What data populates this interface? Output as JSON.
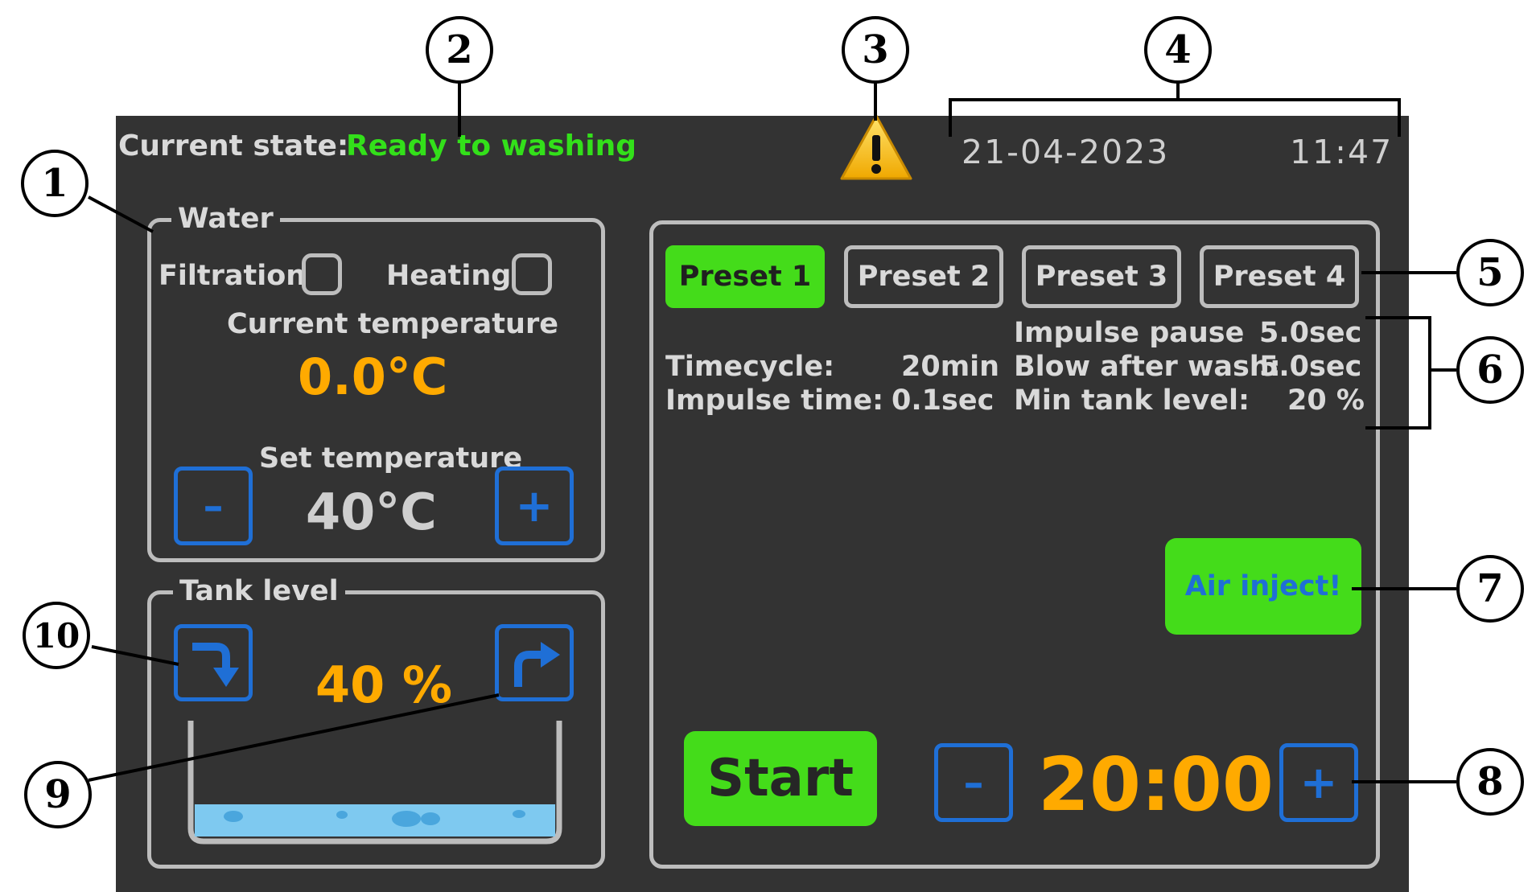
{
  "header": {
    "state_label": "Current state:",
    "state_value": "Ready to washing",
    "warning_icon": "warning-triangle-icon",
    "date": "21-04-2023",
    "time": "11:47"
  },
  "water": {
    "title": "Water",
    "filtration_label": "Filtration",
    "heating_label": "Heating",
    "current_temp_label": "Current temperature",
    "current_temp_value": "0.0°C",
    "set_temp_label": "Set temperature",
    "set_temp_value": "40°C",
    "minus_label": "–",
    "plus_label": "+"
  },
  "tank": {
    "title": "Tank level",
    "level_text": "40 %",
    "level_fraction": 0.4,
    "drain_icon": "arrow-turn-down-icon",
    "fill_icon": "arrow-turn-right-icon"
  },
  "presets": {
    "items": [
      "Preset 1",
      "Preset 2",
      "Preset 3",
      "Preset 4"
    ],
    "active_index": 0
  },
  "params": {
    "timecycle_label": "Timecycle:",
    "timecycle_value": "20min",
    "impulse_time_label": "Impulse time:",
    "impulse_time_value": "0.1sec",
    "impulse_pause_label": "Impulse pause",
    "impulse_pause_value": "5.0sec",
    "blow_label": "Blow after wash:",
    "blow_value": "5.0sec",
    "min_tank_label": "Min tank level:",
    "min_tank_value": "20 %"
  },
  "controls": {
    "air_inject_label": "Air inject!",
    "start_label": "Start",
    "timer_value": "20:00",
    "minus_label": "–",
    "plus_label": "+"
  },
  "callouts": [
    "1",
    "2",
    "3",
    "4",
    "5",
    "6",
    "7",
    "8",
    "9",
    "10"
  ],
  "colors": {
    "screen_bg": "#333333",
    "accent_green": "#44dc1a",
    "status_green": "#33e01a",
    "value_orange": "#ffaa00",
    "button_blue": "#1f6fd6",
    "air_text_blue": "#1f6fd6",
    "border_grey": "#bdbdbd",
    "water_blue": "#7ec9f0"
  }
}
